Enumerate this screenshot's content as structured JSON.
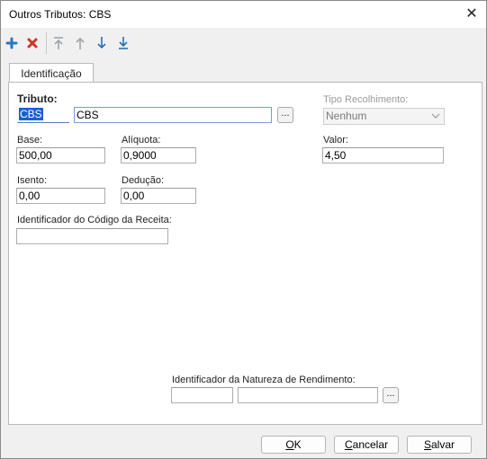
{
  "window": {
    "title": "Outros Tributos: CBS",
    "close_symbol": "✕"
  },
  "toolbar": {
    "icons": [
      "plus-icon",
      "delete-x-icon",
      "move-top-icon",
      "move-up-icon",
      "move-down-icon",
      "move-bottom-icon"
    ],
    "colors": {
      "add": "#2677c4",
      "delete": "#d0342c",
      "disabled": "#9aa5b0",
      "active_arrow": "#2a6fb7"
    }
  },
  "tabs": [
    {
      "label": "Identificação",
      "active": true
    }
  ],
  "form": {
    "tributo": {
      "label": "Tributo:",
      "code": "CBS",
      "description": "CBS",
      "lookup_label": "..."
    },
    "tipo_recolhimento": {
      "label": "Tipo Recolhimento:",
      "value": "Nenhum"
    },
    "base": {
      "label": "Base:",
      "value": "500,00"
    },
    "aliquota": {
      "label": "Alíquota:",
      "value": "0,9000"
    },
    "valor": {
      "label": "Valor:",
      "value": "4,50"
    },
    "isento": {
      "label": "Isento:",
      "value": "0,00"
    },
    "deducao": {
      "label": "Dedução:",
      "value": "0,00"
    },
    "identificador_codigo_receita": {
      "label": "Identificador do Código da Receita:",
      "value": ""
    },
    "identificador_natureza_rendimento": {
      "label": "Identificador da Natureza de Rendimento:",
      "code": "",
      "description": "",
      "lookup_label": "..."
    }
  },
  "buttons": {
    "ok": {
      "label_first": "O",
      "label_rest": "K"
    },
    "cancelar": {
      "label_first": "C",
      "label_rest": "ancelar"
    },
    "salvar": {
      "label_first": "S",
      "label_rest": "alvar"
    }
  }
}
